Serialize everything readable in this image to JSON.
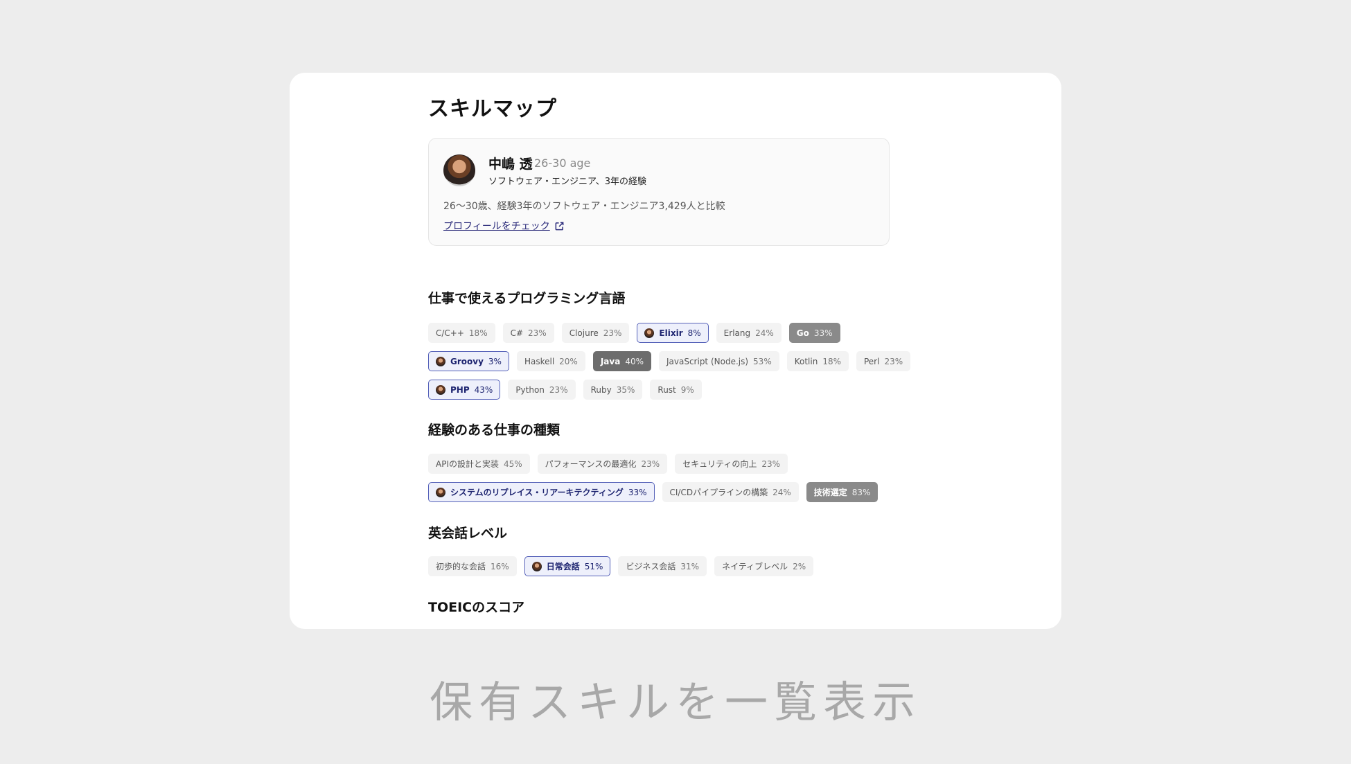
{
  "title": "スキルマップ",
  "profile": {
    "name": "中嶋 透",
    "age": "26-30 age",
    "role": "ソフトウェア・エンジニア、3年の経験",
    "comparison": "26〜30歳、経験3年のソフトウェア・エンジニア3,429人と比較",
    "link_label": "プロフィールをチェック"
  },
  "sections": [
    {
      "title": "仕事で使えるプログラミング言語",
      "rows": [
        [
          {
            "label": "C/C++",
            "pct": "18%",
            "style": "normal"
          },
          {
            "label": "C#",
            "pct": "23%",
            "style": "normal"
          },
          {
            "label": "Clojure",
            "pct": "23%",
            "style": "normal"
          },
          {
            "label": "Elixir",
            "pct": "8%",
            "style": "mine"
          },
          {
            "label": "Erlang",
            "pct": "24%",
            "style": "normal"
          },
          {
            "label": "Go",
            "pct": "33%",
            "style": "dark"
          }
        ],
        [
          {
            "label": "Groovy",
            "pct": "3%",
            "style": "mine"
          },
          {
            "label": "Haskell",
            "pct": "20%",
            "style": "normal"
          },
          {
            "label": "Java",
            "pct": "40%",
            "style": "darker"
          },
          {
            "label": "JavaScript (Node.js)",
            "pct": "53%",
            "style": "normal"
          },
          {
            "label": "Kotlin",
            "pct": "18%",
            "style": "normal"
          },
          {
            "label": "Perl",
            "pct": "23%",
            "style": "normal"
          }
        ],
        [
          {
            "label": "PHP",
            "pct": "43%",
            "style": "mine"
          },
          {
            "label": "Python",
            "pct": "23%",
            "style": "normal"
          },
          {
            "label": "Ruby",
            "pct": "35%",
            "style": "normal"
          },
          {
            "label": "Rust",
            "pct": "9%",
            "style": "normal"
          }
        ]
      ]
    },
    {
      "title": "経験のある仕事の種類",
      "rows": [
        [
          {
            "label": "APIの設計と実装",
            "pct": "45%",
            "style": "normal"
          },
          {
            "label": "パフォーマンスの最適化",
            "pct": "23%",
            "style": "normal"
          },
          {
            "label": "セキュリティの向上",
            "pct": "23%",
            "style": "normal"
          }
        ],
        [
          {
            "label": "システムのリプレイス・リアーキテクティング",
            "pct": "33%",
            "style": "mine"
          },
          {
            "label": "CI/CDパイプラインの構築",
            "pct": "24%",
            "style": "normal"
          },
          {
            "label": "技術選定",
            "pct": "83%",
            "style": "dark"
          }
        ]
      ]
    },
    {
      "title": "英会話レベル",
      "rows": [
        [
          {
            "label": "初歩的な会話",
            "pct": "16%",
            "style": "normal"
          },
          {
            "label": "日常会話",
            "pct": "51%",
            "style": "mine"
          },
          {
            "label": "ビジネス会話",
            "pct": "31%",
            "style": "normal"
          },
          {
            "label": "ネイティブレベル",
            "pct": "2%",
            "style": "normal"
          }
        ]
      ]
    },
    {
      "title": "TOEICのスコア",
      "rows": []
    }
  ],
  "caption": "保有スキルを一覧表示",
  "colors": {
    "background": "#ededed",
    "card": "#ffffff",
    "mine_border": "#5460b8",
    "mine_fill": "#eef0fb",
    "dark_tag": "#8a8a8a",
    "darker_tag": "#6d6d6d"
  }
}
